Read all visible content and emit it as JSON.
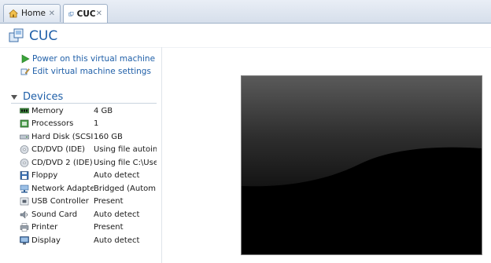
{
  "tabs": [
    {
      "label": "Home",
      "icon": "home-icon"
    },
    {
      "label": "CUC",
      "icon": "vm-icon"
    }
  ],
  "vm": {
    "title": "CUC"
  },
  "actions": [
    {
      "label": "Power on this virtual machine",
      "icon": "power-on-icon"
    },
    {
      "label": "Edit virtual machine settings",
      "icon": "edit-settings-icon"
    }
  ],
  "devices": {
    "heading": "Devices",
    "items": [
      {
        "name": "Memory",
        "value": "4 GB",
        "icon": "memory-icon"
      },
      {
        "name": "Processors",
        "value": "1",
        "icon": "processor-icon"
      },
      {
        "name": "Hard Disk (SCSI)",
        "value": "160 GB",
        "icon": "hard-disk-icon"
      },
      {
        "name": "CD/DVD (IDE)",
        "value": "Using file autoin...",
        "icon": "cd-dvd-icon"
      },
      {
        "name": "CD/DVD 2 (IDE)",
        "value": "Using file C:\\Use...",
        "icon": "cd-dvd-icon"
      },
      {
        "name": "Floppy",
        "value": "Auto detect",
        "icon": "floppy-icon"
      },
      {
        "name": "Network Adapter",
        "value": "Bridged (Autom...",
        "icon": "network-adapter-icon"
      },
      {
        "name": "USB Controller",
        "value": "Present",
        "icon": "usb-icon"
      },
      {
        "name": "Sound Card",
        "value": "Auto detect",
        "icon": "sound-card-icon"
      },
      {
        "name": "Printer",
        "value": "Present",
        "icon": "printer-icon"
      },
      {
        "name": "Display",
        "value": "Auto detect",
        "icon": "display-icon"
      }
    ]
  },
  "colors": {
    "link": "#1f5fa8",
    "power_green": "#3aa33a",
    "preview_bg": "#000000"
  }
}
